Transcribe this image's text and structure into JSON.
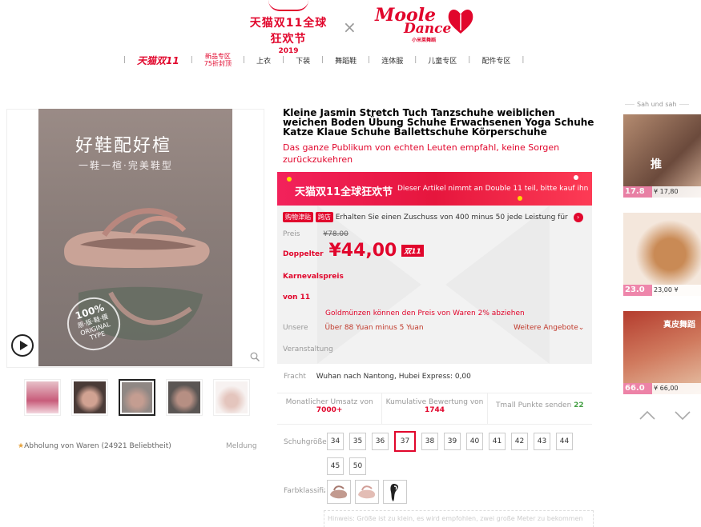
{
  "banner": {
    "tmall_title": "天猫双11全球狂欢节",
    "tmall_year": "2019",
    "times": "×",
    "brand_name_1": "Moole",
    "brand_name_2": "Dance",
    "brand_sub": "小米莱舞蹈"
  },
  "nav": {
    "items": [
      "天猫双11",
      "新品专区\n75折封顶",
      "上衣",
      "下装",
      "舞蹈鞋",
      "连体服",
      "儿童专区",
      "配件专区"
    ],
    "sep": "|"
  },
  "gallery": {
    "headline": "好鞋配好楦",
    "subline": "一鞋一楦·完美鞋型",
    "stamp_top": "100%",
    "stamp_mid": "原·版·鞋·模",
    "stamp_bottom": "ORIGINAL",
    "stamp_type": "TYPE",
    "thumb_count": 5,
    "active_thumb": 3,
    "pickup_text": "Abholung von  Waren (24921 Beliebtheit)",
    "report": "Meldung"
  },
  "product": {
    "title": "Kleine Jasmin Stretch Tuch Tanzschuhe weiblichen weichen Boden Übung Schuhe Erwachsenen Yoga Schuhe Katze Klaue Schuhe Ballettschuhe Körperschuhe",
    "subtitle": "Das ganze Publikum von echten Leuten empfahl, keine Sorgen zurückzukehren"
  },
  "promo": {
    "head_title": "天猫双11全球狂欢节",
    "head_text": "Dieser Artikel nimmt an Double 11 teil, bitte kauf ihn",
    "subsidy_badge": "购物津贴",
    "subsidy_badge2": "跨店",
    "subsidy_text": "Erhalten Sie einen Zuschuss von 400 minus 50 jede Leistung für",
    "price_label": "Preis",
    "old_price": "¥78.00",
    "double_price_label": "Doppelter",
    "price": "¥44,00",
    "double_tag": "双11",
    "carnival": "Karnevalspreis",
    "from": "von 11",
    "gold_text": "Goldmünzen können den Preis von Waren 2% abziehen",
    "our_label": "Unsere",
    "our_text": "Über 88 Yuan minus 5 Yuan",
    "more_offers": "Weitere Angebote",
    "event": "Veranstaltung"
  },
  "shipping": {
    "label": "Fracht",
    "text": "Wuhan  nach Nantong, Hubei Express: 0,00"
  },
  "stats": [
    {
      "label": "Monatlicher Umsatz von",
      "value": "7000+"
    },
    {
      "label": "Kumulative Bewertung von",
      "value": "1744"
    },
    {
      "label": "Tmall Punkte senden",
      "value": "22"
    }
  ],
  "sizes": {
    "label": "Schuhgröße",
    "values": [
      "34",
      "35",
      "36",
      "37",
      "38",
      "39",
      "40",
      "41",
      "42",
      "43",
      "44",
      "45",
      "50"
    ],
    "selected": "37"
  },
  "colors": {
    "label": "Farbklassifizierung",
    "count": 3
  },
  "hint": "Hinweis: Größe ist zu klein, es wird empfohlen, zwei große Meter zu bekommen",
  "sidebar": {
    "title": "Sah und sah",
    "items": [
      {
        "big": "17.8",
        "price": "¥ 17,80"
      },
      {
        "big": "23.0",
        "price": "23,00 ¥"
      },
      {
        "big": "66.0",
        "price": "¥ 66,00"
      }
    ],
    "rec3_text": "真皮舞蹈"
  },
  "colors_theme": {
    "accent": "#e1062c",
    "promo": "#f2225b",
    "green": "#46a046"
  }
}
